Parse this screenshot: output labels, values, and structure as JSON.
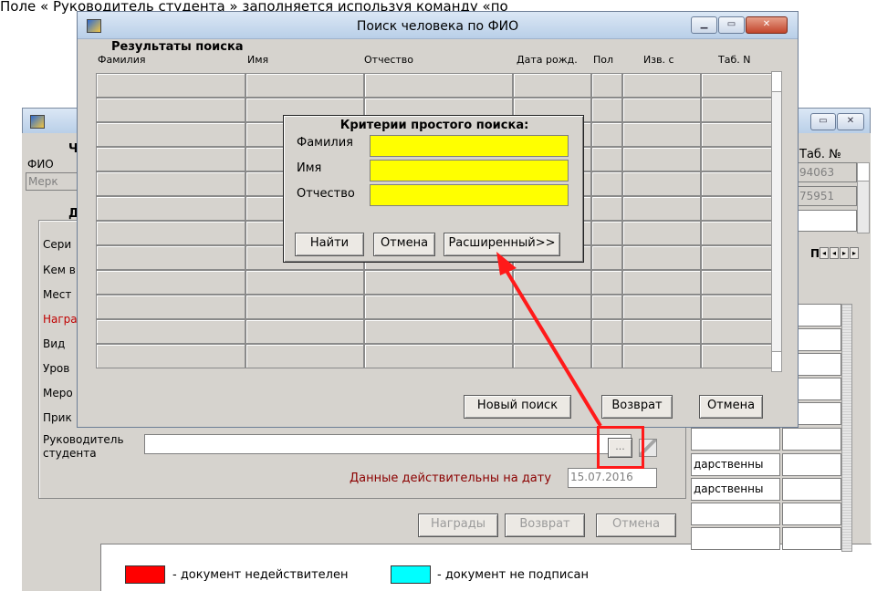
{
  "doc_strip": {
    "text": "Поле « Руководитель студента » заполняется используя команду «по"
  },
  "search_window": {
    "title": "Поиск человека по ФИО",
    "results_heading": "Результаты поиска",
    "columns": [
      "Фамилия",
      "Имя",
      "Отчество",
      "Дата рожд.",
      "Пол",
      "Изв. с",
      "Таб. N"
    ],
    "buttons": {
      "new_search": "Новый поиск",
      "return": "Возврат",
      "cancel": "Отмена"
    }
  },
  "criteria_dialog": {
    "title": "Критерии простого поиска:",
    "fields": [
      {
        "label": "Фамилия",
        "value": ""
      },
      {
        "label": "Имя",
        "value": ""
      },
      {
        "label": "Отчество",
        "value": ""
      }
    ],
    "buttons": {
      "find": "Найти",
      "cancel": "Отмена",
      "advanced": "Расширенный>>"
    }
  },
  "back_window": {
    "heading_partial": "Ч",
    "fio_label": "ФИО",
    "fio_value": "Мерк",
    "section_partial": "Д",
    "rows": [
      "Сери",
      "Кем в",
      "Мест",
      "Награ",
      "Вид",
      "Уров",
      "Меро",
      "Прик"
    ],
    "supervisor_label_1": "Руководитель",
    "supervisor_label_2": "студента",
    "picker_button": "...",
    "valid_date_label": "Данные действительны на дату",
    "valid_date_value": "15.07.2016",
    "buttons": {
      "awards": "Награды",
      "return": "Возврат",
      "cancel": "Отмена"
    },
    "tab_no_label": "Таб. №",
    "tab_values": [
      "94063",
      "75951"
    ],
    "nav_label": "П",
    "state_cells": [
      "дарственны",
      "дарственны"
    ]
  },
  "legend": {
    "red_label": "- документ недействителен",
    "cyan_label": "- документ не подписан",
    "red_color": "#ff0000",
    "cyan_color": "#00ffff"
  },
  "colors": {
    "highlight": "#ff1a1a",
    "required_label": "#c00000"
  }
}
